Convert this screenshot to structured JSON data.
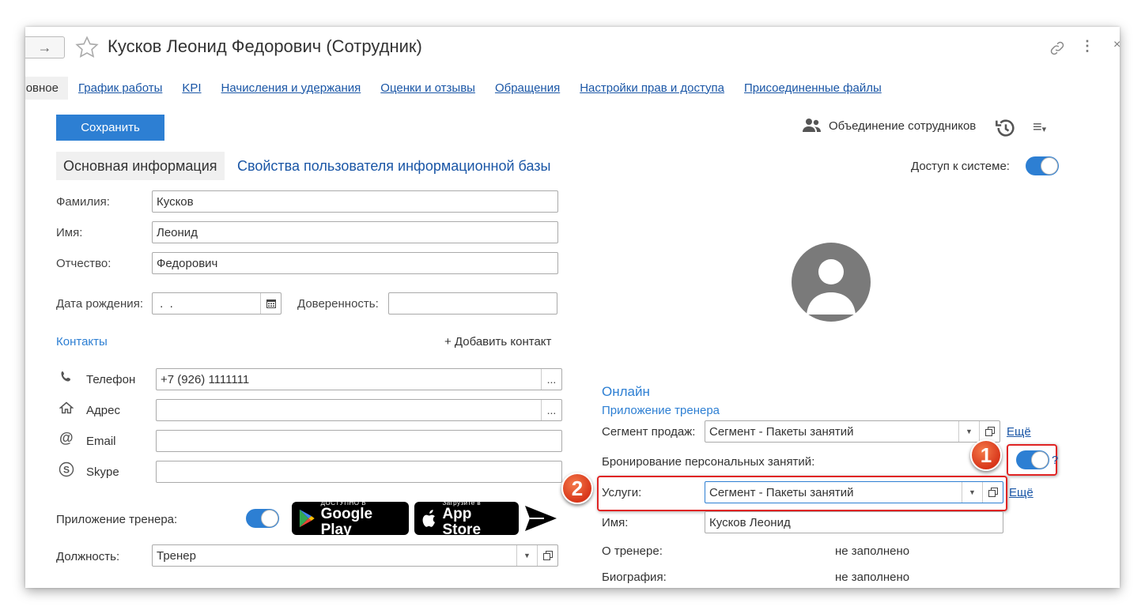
{
  "header": {
    "title": "Кусков Леонид Федорович (Сотрудник)",
    "nav_arrow": "→"
  },
  "tabs": [
    {
      "label": "Основное"
    },
    {
      "label": "График работы"
    },
    {
      "label": "KPI"
    },
    {
      "label": "Начисления и удержания"
    },
    {
      "label": "Оценки и отзывы"
    },
    {
      "label": "Обращения"
    },
    {
      "label": "Настройки прав и доступа"
    },
    {
      "label": "Присоединенные файлы"
    }
  ],
  "toolbar": {
    "save_label": "Сохранить",
    "merge_label": "Объединение сотрудников"
  },
  "subtabs": {
    "active": "Основная информация",
    "other": "Свойства пользователя информационной базы"
  },
  "access": {
    "label": "Доступ к системе:",
    "enabled": true
  },
  "form": {
    "last_name_label": "Фамилия:",
    "last_name_value": "Кусков",
    "first_name_label": "Имя:",
    "first_name_value": "Леонид",
    "patronymic_label": "Отчество:",
    "patronymic_value": "Федорович",
    "birth_label": "Дата рождения:",
    "birth_value": " .  .",
    "proxy_label": "Доверенность:",
    "proxy_value": ""
  },
  "contacts": {
    "title": "Контакты",
    "add_label": "+ Добавить контакт",
    "items": [
      {
        "label": "Телефон",
        "value": "+7 (926) 1111111",
        "icon": "phone-icon"
      },
      {
        "label": "Адрес",
        "value": "",
        "icon": "home-icon"
      },
      {
        "label": "Email",
        "value": "",
        "icon": "at-icon"
      },
      {
        "label": "Skype",
        "value": "",
        "icon": "skype-icon"
      }
    ]
  },
  "trainer_app": {
    "label": "Приложение тренера:",
    "enabled": true,
    "google_small": "ДОСТУПНО В",
    "google_big": "Google Play",
    "apple_small": "Загрузите в",
    "apple_big": "App Store"
  },
  "position": {
    "label": "Должность:",
    "value": "Тренер"
  },
  "online": {
    "title": "Онлайн",
    "subtitle": "Приложение тренера",
    "segment_label": "Сегмент продаж:",
    "segment_value": "Сегмент - Пакеты занятий",
    "more_label": "Ещё",
    "booking_label": "Бронирование персональных занятий:",
    "booking_enabled": true,
    "help": "?",
    "services_label": "Услуги:",
    "services_value": "Сегмент - Пакеты занятий",
    "more_label2": "Ещё",
    "name_label": "Имя:",
    "name_value": "Кусков Леонид",
    "about_label": "О тренере:",
    "about_value": "не заполнено",
    "bio_label": "Биография:",
    "bio_value": "не заполнено"
  },
  "annotations": {
    "marker1": "1",
    "marker2": "2"
  },
  "colors": {
    "accent": "#2d7fd3",
    "link": "#1a56a6",
    "highlight": "#e02424"
  }
}
